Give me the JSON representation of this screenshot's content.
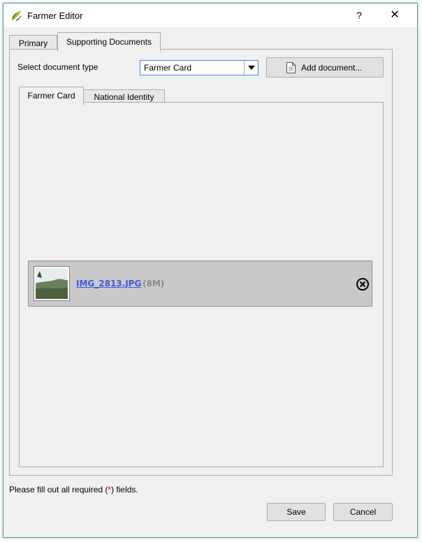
{
  "window": {
    "title": "Farmer Editor",
    "help_label": "?",
    "close_label": "✕"
  },
  "tabs": {
    "outer": [
      {
        "label": "Primary",
        "active": false
      },
      {
        "label": "Supporting Documents",
        "active": true
      }
    ],
    "inner": [
      {
        "label": "Farmer Card",
        "active": true
      },
      {
        "label": "National Identity",
        "active": false
      }
    ]
  },
  "document_type": {
    "label": "Select document type",
    "selected": "Farmer Card"
  },
  "add_document": {
    "label": "Add document..."
  },
  "attachments": [
    {
      "filename": "IMG_2813.JPG",
      "size": "(8M)"
    }
  ],
  "footer": {
    "message_prefix": "Please fill out all required (",
    "required_marker": "*",
    "message_suffix": ") fields."
  },
  "buttons": {
    "save": "Save",
    "cancel": "Cancel"
  },
  "colors": {
    "window_border": "#4aa3a6",
    "link": "#3b5bdb",
    "required": "#d40000",
    "attachment_bg": "#c9c9c9"
  }
}
